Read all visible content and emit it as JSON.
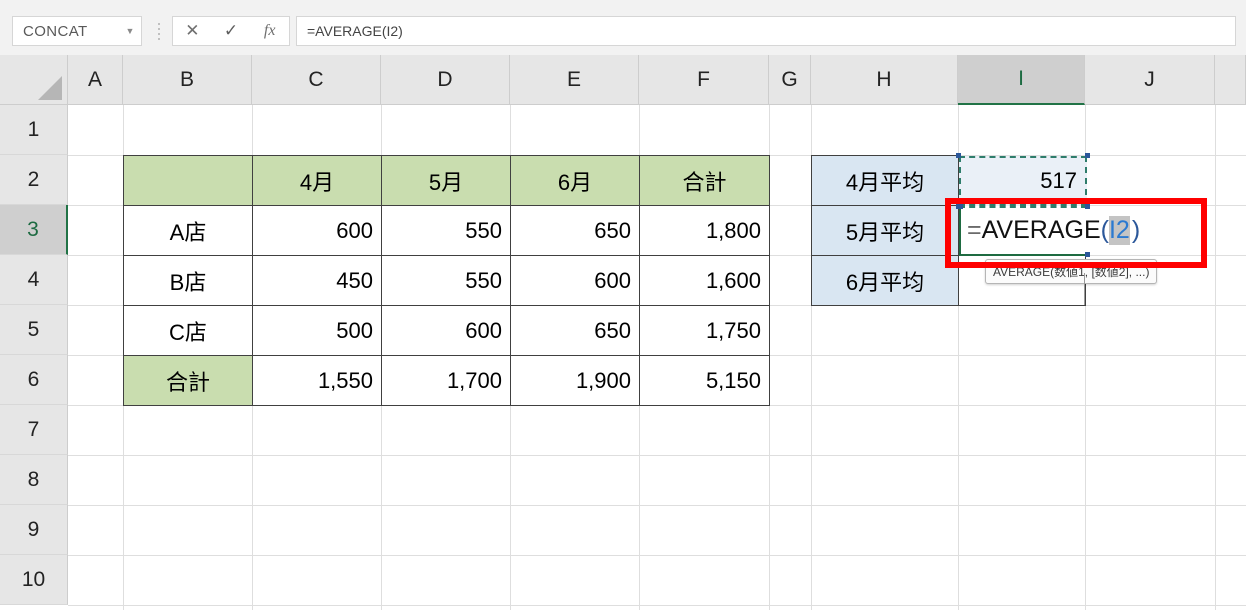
{
  "app": {
    "name_box": {
      "value": "CONCAT",
      "dropdown_icon": "chevron-down-icon"
    },
    "formula_bar": {
      "cancel_icon": "close-icon",
      "accept_icon": "check-icon",
      "insert_function_icon": "fx-icon",
      "insert_function_label": "fx",
      "value": "=AVERAGE(I2)"
    }
  },
  "grid": {
    "columns": [
      "A",
      "B",
      "C",
      "D",
      "E",
      "F",
      "G",
      "H",
      "I",
      "J"
    ],
    "selected_column": "I",
    "rows": [
      "1",
      "2",
      "3",
      "4",
      "5",
      "6",
      "7",
      "8",
      "9",
      "10"
    ],
    "selected_row": "3"
  },
  "sales_table": {
    "header": [
      "",
      "4月",
      "5月",
      "6月",
      "合計"
    ],
    "rows": [
      {
        "label": "A店",
        "values": [
          "600",
          "550",
          "650",
          "1,800"
        ]
      },
      {
        "label": "B店",
        "values": [
          "450",
          "550",
          "600",
          "1,600"
        ]
      },
      {
        "label": "C店",
        "values": [
          "500",
          "600",
          "650",
          "1,750"
        ]
      },
      {
        "label": "合計",
        "values": [
          "1,550",
          "1,700",
          "1,900",
          "5,150"
        ]
      }
    ]
  },
  "average_panel": {
    "labels": [
      "4月平均",
      "5月平均",
      "6月平均"
    ],
    "values": [
      "517",
      "",
      ""
    ]
  },
  "editing_cell": {
    "reference": "I3",
    "equals": "=",
    "function_name": "AVERAGE",
    "open_paren": "(",
    "argument": "I2",
    "close_paren": ")"
  },
  "function_tooltip": {
    "text": "AVERAGE(数値1, [数値2], ...)"
  },
  "annotation": {
    "shape": "rectangle",
    "color": "#ff0000"
  },
  "colors": {
    "header_green": "#c9ddaf",
    "panel_blue": "#d9e6f2",
    "excel_green": "#217346",
    "marching_ants": "#2e7d6b",
    "reference_blue": "#2b7ad1",
    "annotation_red": "#ff0000"
  }
}
